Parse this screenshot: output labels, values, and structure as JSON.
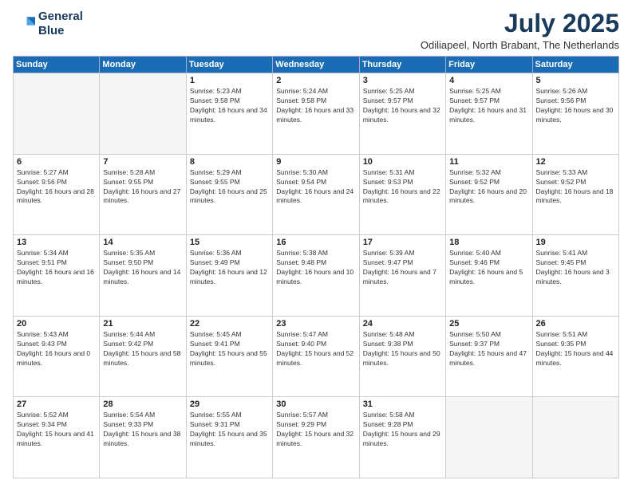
{
  "header": {
    "logo_line1": "General",
    "logo_line2": "Blue",
    "title": "July 2025",
    "subtitle": "Odiliapeel, North Brabant, The Netherlands"
  },
  "days_of_week": [
    "Sunday",
    "Monday",
    "Tuesday",
    "Wednesday",
    "Thursday",
    "Friday",
    "Saturday"
  ],
  "weeks": [
    [
      {
        "num": "",
        "empty": true
      },
      {
        "num": "",
        "empty": true
      },
      {
        "num": "1",
        "sunrise": "5:23 AM",
        "sunset": "9:58 PM",
        "daylight": "16 hours and 34 minutes."
      },
      {
        "num": "2",
        "sunrise": "5:24 AM",
        "sunset": "9:58 PM",
        "daylight": "16 hours and 33 minutes."
      },
      {
        "num": "3",
        "sunrise": "5:25 AM",
        "sunset": "9:57 PM",
        "daylight": "16 hours and 32 minutes."
      },
      {
        "num": "4",
        "sunrise": "5:25 AM",
        "sunset": "9:57 PM",
        "daylight": "16 hours and 31 minutes."
      },
      {
        "num": "5",
        "sunrise": "5:26 AM",
        "sunset": "9:56 PM",
        "daylight": "16 hours and 30 minutes."
      }
    ],
    [
      {
        "num": "6",
        "sunrise": "5:27 AM",
        "sunset": "9:56 PM",
        "daylight": "16 hours and 28 minutes."
      },
      {
        "num": "7",
        "sunrise": "5:28 AM",
        "sunset": "9:55 PM",
        "daylight": "16 hours and 27 minutes."
      },
      {
        "num": "8",
        "sunrise": "5:29 AM",
        "sunset": "9:55 PM",
        "daylight": "16 hours and 25 minutes."
      },
      {
        "num": "9",
        "sunrise": "5:30 AM",
        "sunset": "9:54 PM",
        "daylight": "16 hours and 24 minutes."
      },
      {
        "num": "10",
        "sunrise": "5:31 AM",
        "sunset": "9:53 PM",
        "daylight": "16 hours and 22 minutes."
      },
      {
        "num": "11",
        "sunrise": "5:32 AM",
        "sunset": "9:52 PM",
        "daylight": "16 hours and 20 minutes."
      },
      {
        "num": "12",
        "sunrise": "5:33 AM",
        "sunset": "9:52 PM",
        "daylight": "16 hours and 18 minutes."
      }
    ],
    [
      {
        "num": "13",
        "sunrise": "5:34 AM",
        "sunset": "9:51 PM",
        "daylight": "16 hours and 16 minutes."
      },
      {
        "num": "14",
        "sunrise": "5:35 AM",
        "sunset": "9:50 PM",
        "daylight": "16 hours and 14 minutes."
      },
      {
        "num": "15",
        "sunrise": "5:36 AM",
        "sunset": "9:49 PM",
        "daylight": "16 hours and 12 minutes."
      },
      {
        "num": "16",
        "sunrise": "5:38 AM",
        "sunset": "9:48 PM",
        "daylight": "16 hours and 10 minutes."
      },
      {
        "num": "17",
        "sunrise": "5:39 AM",
        "sunset": "9:47 PM",
        "daylight": "16 hours and 7 minutes."
      },
      {
        "num": "18",
        "sunrise": "5:40 AM",
        "sunset": "9:46 PM",
        "daylight": "16 hours and 5 minutes."
      },
      {
        "num": "19",
        "sunrise": "5:41 AM",
        "sunset": "9:45 PM",
        "daylight": "16 hours and 3 minutes."
      }
    ],
    [
      {
        "num": "20",
        "sunrise": "5:43 AM",
        "sunset": "9:43 PM",
        "daylight": "16 hours and 0 minutes."
      },
      {
        "num": "21",
        "sunrise": "5:44 AM",
        "sunset": "9:42 PM",
        "daylight": "15 hours and 58 minutes."
      },
      {
        "num": "22",
        "sunrise": "5:45 AM",
        "sunset": "9:41 PM",
        "daylight": "15 hours and 55 minutes."
      },
      {
        "num": "23",
        "sunrise": "5:47 AM",
        "sunset": "9:40 PM",
        "daylight": "15 hours and 52 minutes."
      },
      {
        "num": "24",
        "sunrise": "5:48 AM",
        "sunset": "9:38 PM",
        "daylight": "15 hours and 50 minutes."
      },
      {
        "num": "25",
        "sunrise": "5:50 AM",
        "sunset": "9:37 PM",
        "daylight": "15 hours and 47 minutes."
      },
      {
        "num": "26",
        "sunrise": "5:51 AM",
        "sunset": "9:35 PM",
        "daylight": "15 hours and 44 minutes."
      }
    ],
    [
      {
        "num": "27",
        "sunrise": "5:52 AM",
        "sunset": "9:34 PM",
        "daylight": "15 hours and 41 minutes."
      },
      {
        "num": "28",
        "sunrise": "5:54 AM",
        "sunset": "9:33 PM",
        "daylight": "15 hours and 38 minutes."
      },
      {
        "num": "29",
        "sunrise": "5:55 AM",
        "sunset": "9:31 PM",
        "daylight": "15 hours and 35 minutes."
      },
      {
        "num": "30",
        "sunrise": "5:57 AM",
        "sunset": "9:29 PM",
        "daylight": "15 hours and 32 minutes."
      },
      {
        "num": "31",
        "sunrise": "5:58 AM",
        "sunset": "9:28 PM",
        "daylight": "15 hours and 29 minutes."
      },
      {
        "num": "",
        "empty": true
      },
      {
        "num": "",
        "empty": true
      }
    ]
  ]
}
